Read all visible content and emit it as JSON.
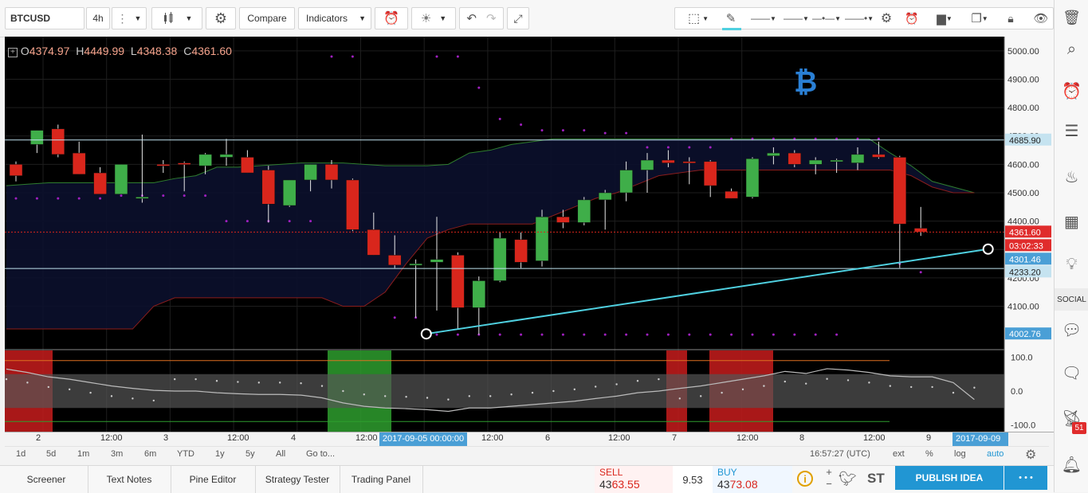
{
  "toolbar": {
    "symbol": "BTCUSD",
    "interval": "4h",
    "compare_label": "Compare",
    "indicators_label": "Indicators"
  },
  "legend": {
    "open_label": "O",
    "open": "4374.97",
    "high_label": "H",
    "high": "4449.99",
    "low_label": "L",
    "low": "4348.38",
    "close_label": "C",
    "close": "4361.60"
  },
  "price_axis": {
    "ticks": [
      "5000.00",
      "4900.00",
      "4800.00",
      "4700.00",
      "4600.00",
      "4500.00",
      "4400.00",
      "4200.00",
      "4100.00"
    ],
    "tags": [
      {
        "text": "4685.90",
        "bg": "#c5e3f0",
        "fg": "#222"
      },
      {
        "text": "4361.60",
        "bg": "#e02c2c",
        "fg": "#ffffff"
      },
      {
        "text": "03:02:33",
        "bg": "#e02c2c",
        "fg": "#ffffff"
      },
      {
        "text": "4301.46",
        "bg": "#4a9fd6",
        "fg": "#ffffff"
      },
      {
        "text": "4233.20",
        "bg": "#c5e3f0",
        "fg": "#222"
      },
      {
        "text": "4002.76",
        "bg": "#4a9fd6",
        "fg": "#ffffff"
      }
    ]
  },
  "osc_axis": {
    "ticks": [
      "100.0",
      "0.0",
      "-100.0"
    ]
  },
  "time_axis": {
    "labels": [
      "2",
      "12:00",
      "3",
      "12:00",
      "4",
      "12:00",
      "12:00",
      "6",
      "12:00",
      "7",
      "12:00",
      "8",
      "12:00",
      "9"
    ],
    "highlight_left": "2017-09-05 00:00:00",
    "highlight_right": "2017-09-09"
  },
  "periods": {
    "items": [
      "1d",
      "5d",
      "1m",
      "3m",
      "6m",
      "YTD",
      "1y",
      "5y",
      "All"
    ],
    "goto": "Go to...",
    "clock": "16:57:27 (UTC)",
    "ext": "ext",
    "pct": "%",
    "log": "log",
    "auto": "auto"
  },
  "bottom_tabs": [
    "Screener",
    "Text Notes",
    "Pine Editor",
    "Strategy Tester",
    "Trading Panel"
  ],
  "trade": {
    "sell_label": "SELL",
    "sell_big": "43",
    "sell_rest": "63.55",
    "spread": "9.53",
    "buy_label": "BUY",
    "buy_big": "43",
    "buy_rest": "73.08"
  },
  "publish": {
    "label": "PUBLISH IDEA",
    "more": "• • •"
  },
  "sidebar": {
    "social": "SOCIAL",
    "badge": "51"
  },
  "share": {
    "st": "ST"
  },
  "colors": {
    "up": "#3fae49",
    "down": "#d9261c",
    "trend": "#4fd0e0",
    "dots": "#a020c0",
    "background": "#000000",
    "accent": "#2196d3"
  },
  "chart_data": {
    "type": "candlestick",
    "symbol": "BTCUSD",
    "interval": "4h",
    "ylim": [
      3950,
      5050
    ],
    "candles": [
      {
        "o": 4600,
        "h": 4610,
        "l": 4540,
        "c": 4560
      },
      {
        "o": 4670,
        "h": 4720,
        "l": 4640,
        "c": 4720
      },
      {
        "o": 4725,
        "h": 4740,
        "l": 4625,
        "c": 4635
      },
      {
        "o": 4640,
        "h": 4680,
        "l": 4590,
        "c": 4565
      },
      {
        "o": 4570,
        "h": 4590,
        "l": 4495,
        "c": 4495
      },
      {
        "o": 4495,
        "h": 4510,
        "l": 4600,
        "c": 4600
      },
      {
        "o": 4480,
        "h": 4705,
        "l": 4465,
        "c": 4485
      },
      {
        "o": 4600,
        "h": 4615,
        "l": 4570,
        "c": 4595
      },
      {
        "o": 4605,
        "h": 4610,
        "l": 4505,
        "c": 4600
      },
      {
        "o": 4595,
        "h": 4640,
        "l": 4565,
        "c": 4635
      },
      {
        "o": 4625,
        "h": 4690,
        "l": 4595,
        "c": 4635
      },
      {
        "o": 4625,
        "h": 4650,
        "l": 4585,
        "c": 4570
      },
      {
        "o": 4580,
        "h": 4595,
        "l": 4395,
        "c": 4460
      },
      {
        "o": 4455,
        "h": 4545,
        "l": 4450,
        "c": 4545
      },
      {
        "o": 4545,
        "h": 4565,
        "l": 4505,
        "c": 4600
      },
      {
        "o": 4600,
        "h": 4615,
        "l": 4515,
        "c": 4545
      },
      {
        "o": 4545,
        "h": 4550,
        "l": 4365,
        "c": 4370
      },
      {
        "o": 4370,
        "h": 4430,
        "l": 4285,
        "c": 4280
      },
      {
        "o": 4280,
        "h": 4350,
        "l": 4235,
        "c": 4245
      },
      {
        "o": 4250,
        "h": 4265,
        "l": 4060,
        "c": 4250
      },
      {
        "o": 4255,
        "h": 4415,
        "l": 4085,
        "c": 4265
      },
      {
        "o": 4280,
        "h": 4290,
        "l": 4020,
        "c": 4095
      },
      {
        "o": 4095,
        "h": 4205,
        "l": 4000,
        "c": 4190
      },
      {
        "o": 4190,
        "h": 4360,
        "l": 4185,
        "c": 4340
      },
      {
        "o": 4335,
        "h": 4360,
        "l": 4235,
        "c": 4255
      },
      {
        "o": 4260,
        "h": 4440,
        "l": 4240,
        "c": 4415
      },
      {
        "o": 4415,
        "h": 4440,
        "l": 4375,
        "c": 4395
      },
      {
        "o": 4395,
        "h": 4485,
        "l": 4385,
        "c": 4475
      },
      {
        "o": 4475,
        "h": 4510,
        "l": 4370,
        "c": 4500
      },
      {
        "o": 4500,
        "h": 4610,
        "l": 4470,
        "c": 4580
      },
      {
        "o": 4580,
        "h": 4640,
        "l": 4500,
        "c": 4615
      },
      {
        "o": 4615,
        "h": 4650,
        "l": 4590,
        "c": 4605
      },
      {
        "o": 4610,
        "h": 4625,
        "l": 4530,
        "c": 4605
      },
      {
        "o": 4610,
        "h": 4615,
        "l": 4485,
        "c": 4525
      },
      {
        "o": 4505,
        "h": 4515,
        "l": 4480,
        "c": 4480
      },
      {
        "o": 4485,
        "h": 4625,
        "l": 4480,
        "c": 4620
      },
      {
        "o": 4630,
        "h": 4660,
        "l": 4600,
        "c": 4640
      },
      {
        "o": 4640,
        "h": 4650,
        "l": 4590,
        "c": 4600
      },
      {
        "o": 4600,
        "h": 4625,
        "l": 4565,
        "c": 4615
      },
      {
        "o": 4615,
        "h": 4620,
        "l": 4570,
        "c": 4615
      },
      {
        "o": 4605,
        "h": 4660,
        "l": 4580,
        "c": 4635
      },
      {
        "o": 4635,
        "h": 4680,
        "l": 4620,
        "c": 4625
      },
      {
        "o": 4625,
        "h": 4630,
        "l": 4235,
        "c": 4390
      },
      {
        "o": 4375,
        "h": 4450,
        "l": 4348,
        "c": 4362
      }
    ],
    "cloud_upper": [
      4525,
      4530,
      4535,
      4535,
      4535,
      4535,
      4535,
      4535,
      4550,
      4560,
      4590,
      4590,
      4595,
      4600,
      4605,
      4605,
      4605,
      4600,
      4595,
      4595,
      4595,
      4600,
      4640,
      4650,
      4670,
      4680,
      4690,
      4690,
      4690,
      4690,
      4690,
      4690,
      4690,
      4690,
      4690,
      4690,
      4690,
      4690,
      4690,
      4690,
      4690,
      4690,
      4640,
      4595,
      4540,
      4520,
      4500
    ],
    "cloud_lower": [
      4020,
      4020,
      4020,
      4020,
      4020,
      4020,
      4020,
      4100,
      4130,
      4130,
      4130,
      4130,
      4130,
      4130,
      4130,
      4130,
      4100,
      4100,
      4150,
      4250,
      4340,
      4370,
      4390,
      4390,
      4390,
      4390,
      4420,
      4450,
      4480,
      4500,
      4530,
      4560,
      4570,
      4580,
      4580,
      4580,
      4580,
      4580,
      4580,
      4580,
      4580,
      4580,
      4580,
      4560,
      4520,
      4500,
      4500
    ],
    "trendline": {
      "from": {
        "index": 19.5,
        "value": 4002.76
      },
      "to": {
        "index": 46.2,
        "value": 4301.46
      }
    },
    "hlines": [
      4685.9,
      4233.2
    ],
    "current_price": 4361.6,
    "oscillator": {
      "ylim": [
        -120,
        120
      ],
      "bands": [
        50,
        -50
      ],
      "values": [
        65,
        55,
        42,
        35,
        25,
        15,
        8,
        2,
        0,
        0,
        -5,
        -8,
        -10,
        -10,
        -12,
        -20,
        -35,
        -45,
        -50,
        -52,
        -55,
        -60,
        -50,
        -50,
        -45,
        -40,
        -35,
        -30,
        -22,
        -15,
        -5,
        0,
        8,
        15,
        25,
        35,
        45,
        58,
        52,
        66,
        62,
        55,
        45,
        42,
        42,
        25,
        -25
      ]
    }
  }
}
